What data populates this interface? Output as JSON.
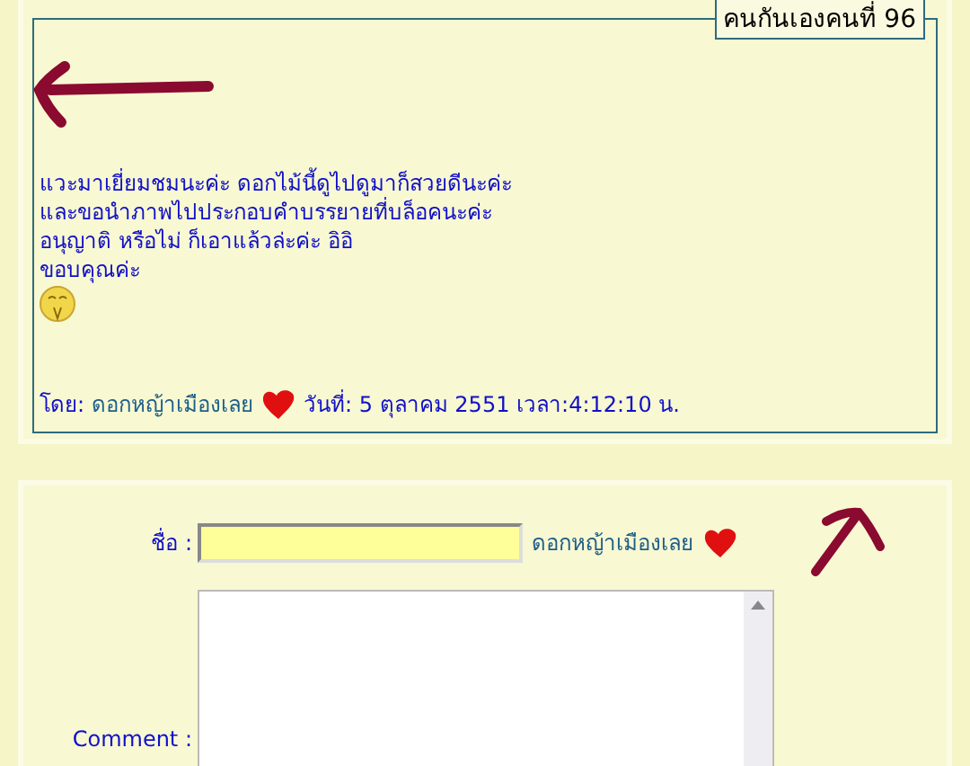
{
  "post": {
    "legend": "คนกันเองคนที่ 96",
    "message_lines": [
      "แวะมาเยี่ยมชมนะค่ะ ดอกไม้นี้ดูไปดูมาก็สวยดีนะค่ะ",
      "และขอนำภาพไปประกอบคำบรรยายที่บล็อคนะค่ะ",
      "อนุญาติ หรือไม่ ก็เอาแล้วล่ะค่ะ อิอิ",
      "ขอบคุณค่ะ"
    ],
    "author_label": "โดย:",
    "author_name": "ดอกหญ้าเมืองเลย",
    "date_text": "วันที่: 5 ตุลาคม 2551 เวลา:4:12:10 น."
  },
  "form": {
    "name_label": "ชื่อ :",
    "name_hint": "ดอกหญ้าเมืองเลย",
    "comment_label": "Comment :"
  }
}
